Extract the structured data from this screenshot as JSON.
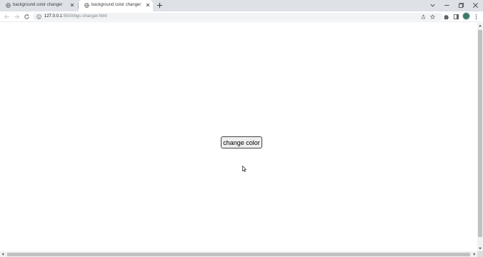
{
  "browser": {
    "tabs": [
      {
        "title": "background color changer",
        "favicon": "globe-icon",
        "active": false
      },
      {
        "title": "background color changer",
        "favicon": "globe-icon",
        "active": true
      }
    ],
    "url_host": "127.0.0.1",
    "url_rest": ":5500/bgc-changer.html",
    "toolbar_icons": [
      "back-icon",
      "forward-icon",
      "reload-icon",
      "info-icon",
      "share-icon",
      "star-icon",
      "extensions-icon",
      "side-panel-icon",
      "profile-avatar",
      "menu-icon"
    ],
    "window_controls": [
      "tab-search-icon",
      "minimize-icon",
      "restore-icon",
      "close-icon"
    ]
  },
  "page": {
    "button_label": "change color",
    "background_color": "#ffffff"
  },
  "colors": {
    "tabstrip": "#dee1e6",
    "omnibox": "#f1f3f4",
    "button_bg": "#efefef"
  }
}
